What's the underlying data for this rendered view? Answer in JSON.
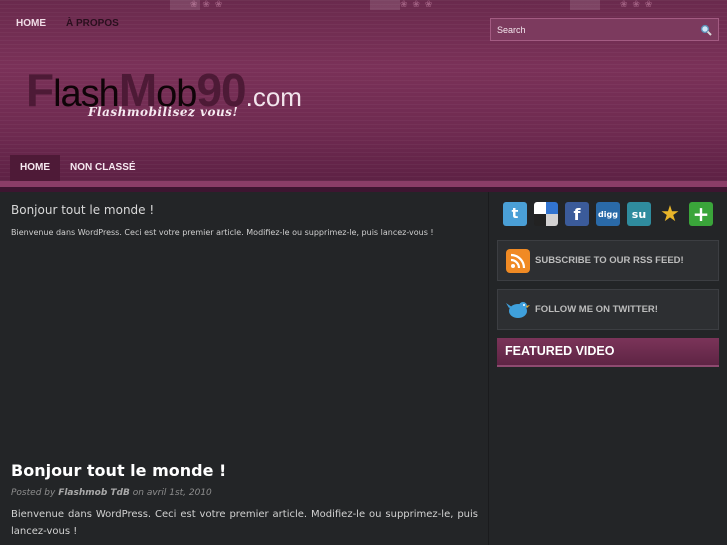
{
  "top_nav": {
    "items": [
      {
        "label": "HOME"
      },
      {
        "label": "À PROPOS"
      }
    ]
  },
  "search": {
    "placeholder": "Search"
  },
  "logo": {
    "part_f": "F",
    "part_lash": "lash",
    "part_m": "M",
    "part_ob": "ob",
    "part_90": "90",
    "part_com": ".com",
    "tagline": "Flashmobilisez vous!"
  },
  "main_nav": {
    "items": [
      {
        "label": "HOME",
        "active": true
      },
      {
        "label": "NON CLASSÉ",
        "active": false
      }
    ]
  },
  "featured_excerpt": {
    "title": "Bonjour tout le monde !",
    "text": "Bienvenue dans WordPress. Ceci est votre premier article. Modifiez-le ou supprimez-le, puis lancez-vous !"
  },
  "post": {
    "title": "Bonjour tout le monde !",
    "meta_prefix": "Posted by",
    "author": "Flashmob TdB",
    "meta_on": "on",
    "date": "avril 1st, 2010",
    "body": "Bienvenue dans WordPress. Ceci est votre premier article. Modifiez-le ou supprimez-le, puis lancez-vous !"
  },
  "sidebar": {
    "social_icons": [
      {
        "name": "twitter-icon",
        "color": "#4a9fd6",
        "glyph": "t"
      },
      {
        "name": "delicious-icon",
        "color": "#1e1e1e",
        "glyph": ""
      },
      {
        "name": "facebook-icon",
        "color": "#3b5b9a",
        "glyph": "f"
      },
      {
        "name": "digg-icon",
        "color": "#2a6aa8",
        "glyph": "digg"
      },
      {
        "name": "stumbleupon-icon",
        "color": "#2f8c9e",
        "glyph": "su"
      },
      {
        "name": "favorite-star-icon",
        "color": "#e0b530",
        "glyph": "★"
      },
      {
        "name": "add-plus-icon",
        "color": "#3aa53a",
        "glyph": "+"
      }
    ],
    "rss_label": "SUBSCRIBE TO OUR RSS FEED!",
    "twitter_label": "FOLLOW ME ON TWITTER!",
    "featured_video_heading": "FEATURED VIDEO"
  },
  "colors": {
    "header_bg": "#6e2a50",
    "page_bg": "#232527",
    "accent": "#7b3459"
  }
}
